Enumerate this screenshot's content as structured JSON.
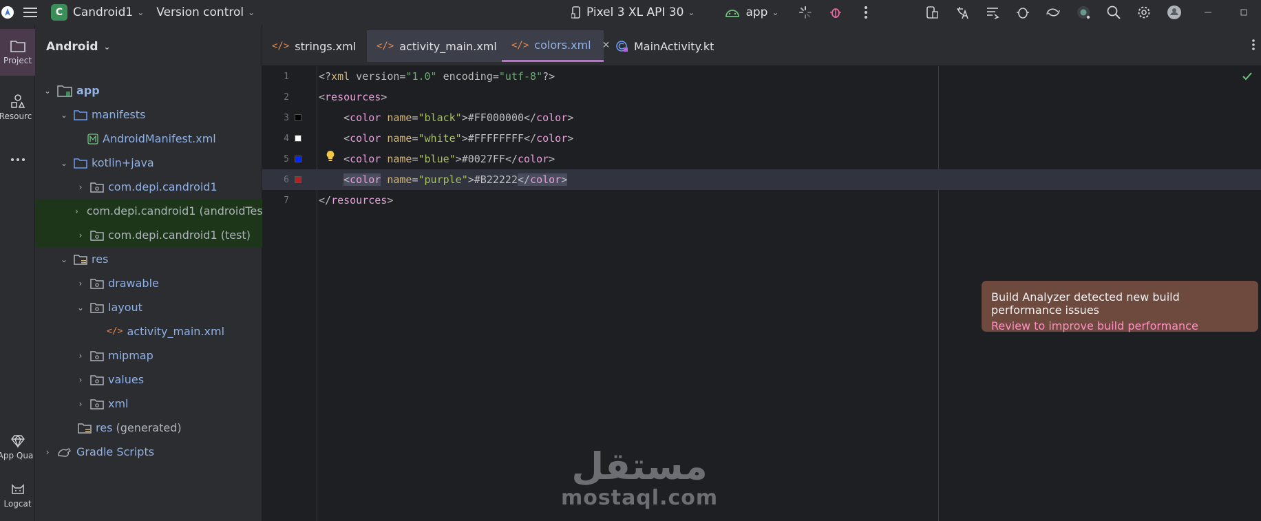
{
  "titlebar": {
    "project_badge": "C",
    "project_name": "Candroid1",
    "vcs": "Version control",
    "device": "Pixel 3 XL API 30",
    "run_config": "app"
  },
  "stripe": {
    "project": "Project",
    "resources": "Resourc",
    "quality": "App Qua",
    "logcat": "Logcat"
  },
  "panel": {
    "view_mode": "Android",
    "tree": [
      {
        "label": "app",
        "extra": ""
      },
      {
        "label": "manifests",
        "extra": ""
      },
      {
        "label": "AndroidManifest.xml",
        "extra": ""
      },
      {
        "label": "kotlin+java",
        "extra": ""
      },
      {
        "label": "com.depi.candroid1",
        "extra": ""
      },
      {
        "label": "com.depi.candroid1",
        "extra": " (androidTest)"
      },
      {
        "label": "com.depi.candroid1",
        "extra": " (test)"
      },
      {
        "label": "res",
        "extra": ""
      },
      {
        "label": "drawable",
        "extra": ""
      },
      {
        "label": "layout",
        "extra": ""
      },
      {
        "label": "activity_main.xml",
        "extra": ""
      },
      {
        "label": "mipmap",
        "extra": ""
      },
      {
        "label": "values",
        "extra": ""
      },
      {
        "label": "xml",
        "extra": ""
      },
      {
        "label": "res",
        "extra": " (generated)"
      },
      {
        "label": "Gradle Scripts",
        "extra": ""
      }
    ]
  },
  "tabs": [
    {
      "label": "strings.xml"
    },
    {
      "label": "activity_main.xml"
    },
    {
      "label": "colors.xml"
    },
    {
      "label": "MainActivity.kt"
    }
  ],
  "editor": {
    "line_numbers": [
      "1",
      "2",
      "3",
      "4",
      "5",
      "6",
      "7"
    ],
    "l1_a": "<?",
    "l1_b": "xml",
    "l1_c": " version=",
    "l1_d": "\"1.0\"",
    "l1_e": " encoding=",
    "l1_f": "\"utf-8\"",
    "l1_g": "?>",
    "resources_tag": "resources",
    "color_tag": "color",
    "name_attr": "name",
    "colors": [
      {
        "name": "\"black\"",
        "value": "#FF000000",
        "swatch": "#000000"
      },
      {
        "name": "\"white\"",
        "value": "#FFFFFFFF",
        "swatch": "#ffffff"
      },
      {
        "name": "\"blue\"",
        "value": "#0027FF",
        "swatch": "#0027ff"
      },
      {
        "name": "\"purple\"",
        "value": "#B22222",
        "swatch": "#b22222"
      }
    ]
  },
  "notification": {
    "title": "Build Analyzer detected new build performance issues",
    "link": "Review to improve build performance"
  },
  "watermark": {
    "arabic": "مستقل",
    "latin": "mostaql.com"
  }
}
